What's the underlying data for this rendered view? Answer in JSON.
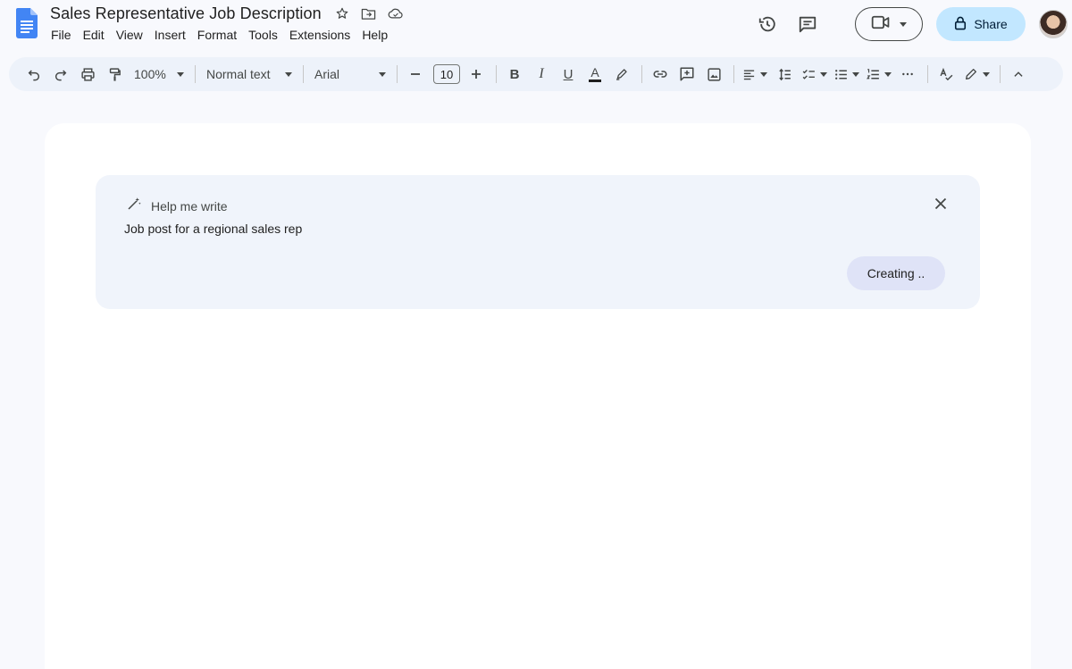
{
  "header": {
    "title": "Sales Representative Job Description",
    "title_icons": [
      "star-icon",
      "move-to-folder-icon",
      "cloud-saved-icon"
    ],
    "menu": [
      "File",
      "Edit",
      "View",
      "Insert",
      "Format",
      "Tools",
      "Extensions",
      "Help"
    ],
    "share_label": "Share",
    "brand_color": "#4285f4",
    "share_bg": "#c2e7ff"
  },
  "toolbar": {
    "zoom": "100%",
    "style": "Normal text",
    "font": "Arial",
    "font_size": "10",
    "bold": "B",
    "italic": "I",
    "underline": "U",
    "text_color": "A",
    "text_color_bar": "#1f1f1f",
    "toolbar_bg": "#edf2fa"
  },
  "help_me_write": {
    "label": "Help me write",
    "prompt": "Job post for a regional sales rep",
    "button_label": "Creating ..",
    "panel_bg": "#f0f4fb",
    "button_bg": "#dfe3f7"
  }
}
